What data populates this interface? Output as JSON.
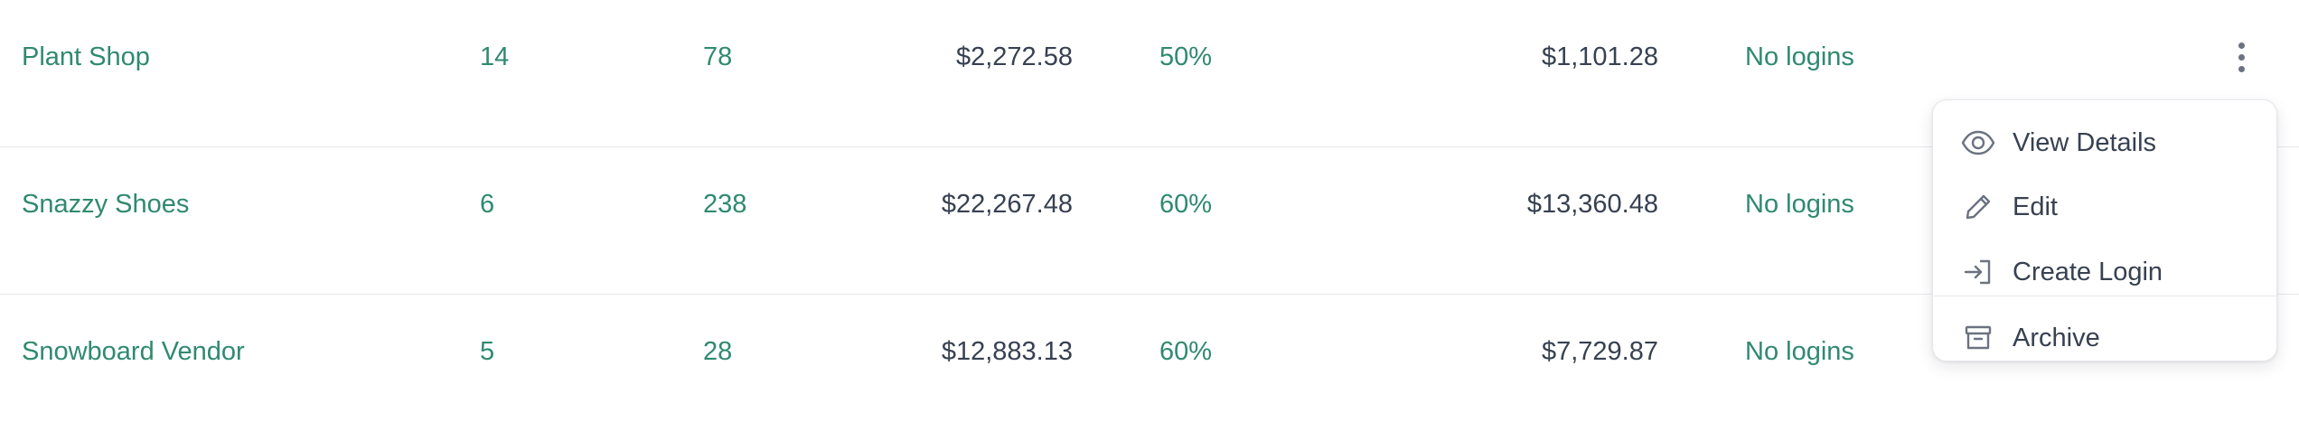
{
  "rows": [
    {
      "name": "Plant Shop",
      "a": "14",
      "b": "78",
      "amount": "$2,272.58",
      "pct": "50%",
      "amount2": "$1,101.28",
      "logins": "No logins"
    },
    {
      "name": "Snazzy Shoes",
      "a": "6",
      "b": "238",
      "amount": "$22,267.48",
      "pct": "60%",
      "amount2": "$13,360.48",
      "logins": "No logins"
    },
    {
      "name": "Snowboard Vendor",
      "a": "5",
      "b": "28",
      "amount": "$12,883.13",
      "pct": "60%",
      "amount2": "$7,729.87",
      "logins": "No logins"
    }
  ],
  "menu": {
    "view_details": "View Details",
    "edit": "Edit",
    "create_login": "Create Login",
    "archive": "Archive"
  },
  "icons": {
    "kebab": "more-vertical-icon",
    "view": "eye-icon",
    "edit": "pencil-icon",
    "create_login": "sign-in-arrow-icon",
    "archive": "archive-box-icon"
  },
  "colors": {
    "link_green": "#2f8a6e",
    "text_dark": "#374151",
    "divider": "#e5e7eb"
  }
}
